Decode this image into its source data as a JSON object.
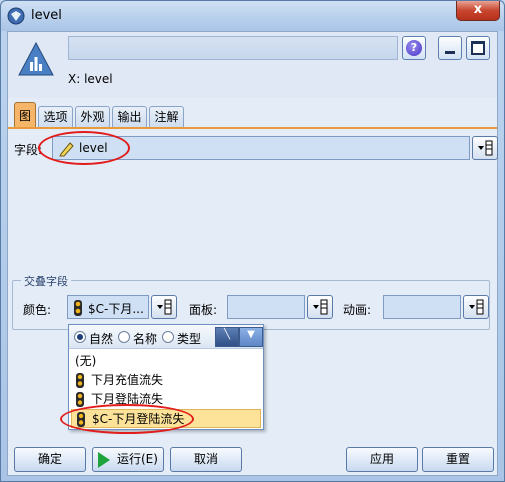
{
  "window": {
    "title": "level",
    "close_label": "x"
  },
  "header": {
    "node_caption": "X: level",
    "help_label": "?"
  },
  "tabs": [
    {
      "label": "图",
      "active": true
    },
    {
      "label": "选项",
      "active": false
    },
    {
      "label": "外观",
      "active": false
    },
    {
      "label": "输出",
      "active": false
    },
    {
      "label": "注解",
      "active": false
    }
  ],
  "field": {
    "label": "字段:",
    "value": "level"
  },
  "overlay": {
    "legend": "交叠字段",
    "color_label": "颜色:",
    "color_value": "$C-下月...",
    "panel_label": "面板:",
    "panel_value": "",
    "animation_label": "动画:",
    "animation_value": ""
  },
  "dropdown": {
    "sort_options": [
      {
        "label": "自然",
        "selected": true
      },
      {
        "label": "名称",
        "selected": false
      },
      {
        "label": "类型",
        "selected": false
      }
    ],
    "items": [
      {
        "label": "(无)",
        "has_icon": false,
        "selected": false
      },
      {
        "label": "下月充值流失",
        "has_icon": true,
        "selected": false
      },
      {
        "label": "下月登陆流失",
        "has_icon": true,
        "selected": false
      },
      {
        "label": "$C-下月登陆流失",
        "has_icon": true,
        "selected": true
      }
    ]
  },
  "footer": {
    "ok_label": "确定",
    "run_label": "运行(E)",
    "cancel_label": "取消",
    "apply_label": "应用",
    "reset_label": "重置"
  },
  "colors": {
    "active_tab": "#f5b66a",
    "selection": "#fde39a",
    "highlight_ellipse": "#e21b1b"
  }
}
